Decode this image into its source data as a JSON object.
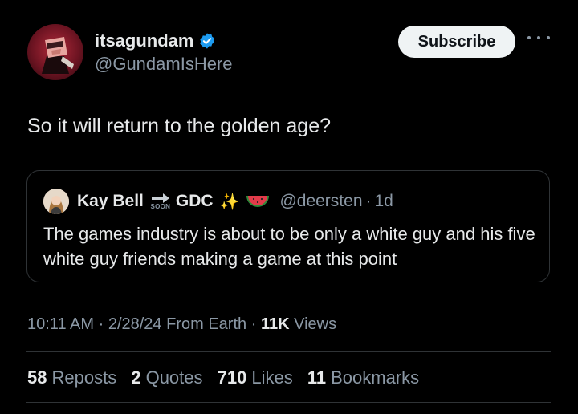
{
  "author": {
    "display_name": "itsagundam",
    "handle": "@GundamIsHere",
    "verified": true,
    "avatar_icon": "avatar-image"
  },
  "actions": {
    "subscribe_label": "Subscribe",
    "more_icon": "more-horizontal-icon"
  },
  "tweet": {
    "text": "So it will return to the golden age?"
  },
  "quote": {
    "name_part1": "Kay Bell",
    "soon_label": "SOON",
    "name_part2": "GDC",
    "sparkles": "✨",
    "handle": "@deersten",
    "separator": "·",
    "age": "1d",
    "text": "The games industry is about to be only a white guy and his five white guy friends making a game at this point"
  },
  "meta": {
    "time": "10:11 AM",
    "sep1": "·",
    "date": "2/28/24",
    "source": "From Earth",
    "sep2": "·",
    "views_count": "11K",
    "views_label": "Views"
  },
  "stats": {
    "reposts_count": "58",
    "reposts_label": "Reposts",
    "quotes_count": "2",
    "quotes_label": "Quotes",
    "likes_count": "710",
    "likes_label": "Likes",
    "bookmarks_count": "11",
    "bookmarks_label": "Bookmarks"
  },
  "colors": {
    "background": "#000000",
    "text": "#e7e9ea",
    "secondary": "#8b98a5",
    "verified_blue": "#1d9bf0",
    "border": "#2f3336"
  }
}
